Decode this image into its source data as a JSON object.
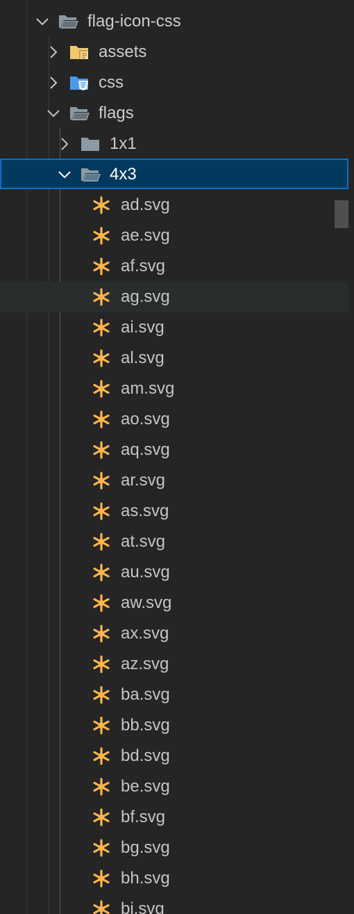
{
  "explorer": {
    "tree": [
      {
        "label": "flag-icon-css",
        "type": "folder",
        "expanded": true,
        "icon": "folder-open-icon"
      },
      {
        "label": "assets",
        "type": "folder",
        "expanded": false,
        "icon": "assets-folder-icon"
      },
      {
        "label": "css",
        "type": "folder",
        "expanded": false,
        "icon": "css-folder-icon"
      },
      {
        "label": "flags",
        "type": "folder",
        "expanded": true,
        "icon": "folder-open-icon"
      },
      {
        "label": "1x1",
        "type": "folder",
        "expanded": false,
        "icon": "folder-icon"
      },
      {
        "label": "4x3",
        "type": "folder",
        "expanded": true,
        "selected": true,
        "icon": "folder-open-icon"
      }
    ],
    "files": [
      "ad.svg",
      "ae.svg",
      "af.svg",
      "ag.svg",
      "ai.svg",
      "al.svg",
      "am.svg",
      "ao.svg",
      "aq.svg",
      "ar.svg",
      "as.svg",
      "at.svg",
      "au.svg",
      "aw.svg",
      "ax.svg",
      "az.svg",
      "ba.svg",
      "bb.svg",
      "bd.svg",
      "be.svg",
      "bf.svg",
      "bg.svg",
      "bh.svg",
      "bi.svg"
    ],
    "file_icon": "svg-file-icon",
    "hovered_file": "ag.svg"
  },
  "colors": {
    "background": "#252526",
    "selection_background": "#04395e",
    "selection_border": "#0e70c0",
    "hover_background": "#2a2d2e",
    "svg_icon": "#ffb54a",
    "folder_icon": "#8c9aa3",
    "assets_folder_icon": "#f0c870",
    "css_folder_icon": "#4b9ae6"
  }
}
